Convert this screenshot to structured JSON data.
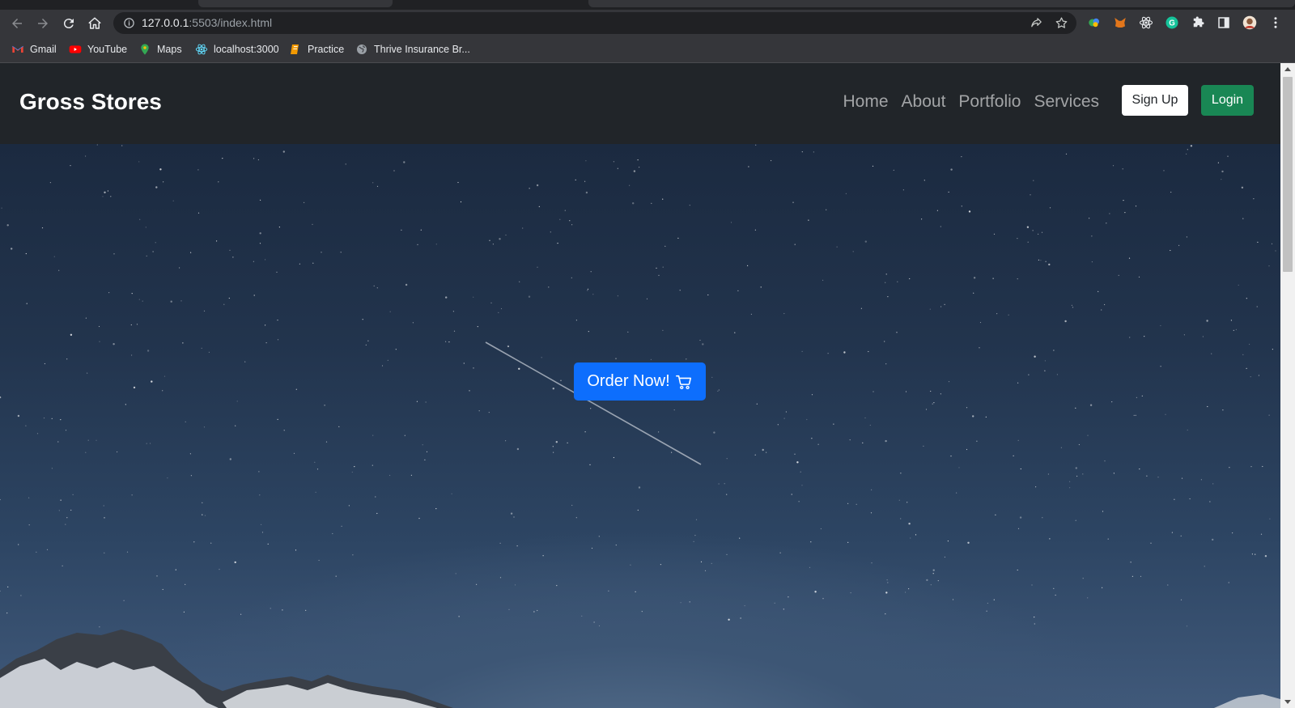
{
  "browser": {
    "url_host": "127.0.0.1",
    "url_rest": ":5503/index.html",
    "bookmarks": [
      {
        "label": "Gmail",
        "icon": "gmail-icon"
      },
      {
        "label": "YouTube",
        "icon": "youtube-icon"
      },
      {
        "label": "Maps",
        "icon": "maps-icon"
      },
      {
        "label": "localhost:3000",
        "icon": "react-icon"
      },
      {
        "label": "Practice",
        "icon": "bookmark-book-icon"
      },
      {
        "label": "Thrive Insurance Br...",
        "icon": "globe-icon"
      }
    ]
  },
  "site": {
    "brand": "Gross Stores",
    "nav": [
      "Home",
      "About",
      "Portfolio",
      "Services"
    ],
    "signup_label": "Sign Up",
    "login_label": "Login",
    "hero_button": "Order Now!"
  },
  "colors": {
    "navbar_bg": "#212529",
    "signup_bg": "#ffffff",
    "login_bg": "#198754",
    "order_bg": "#0d6efd"
  }
}
